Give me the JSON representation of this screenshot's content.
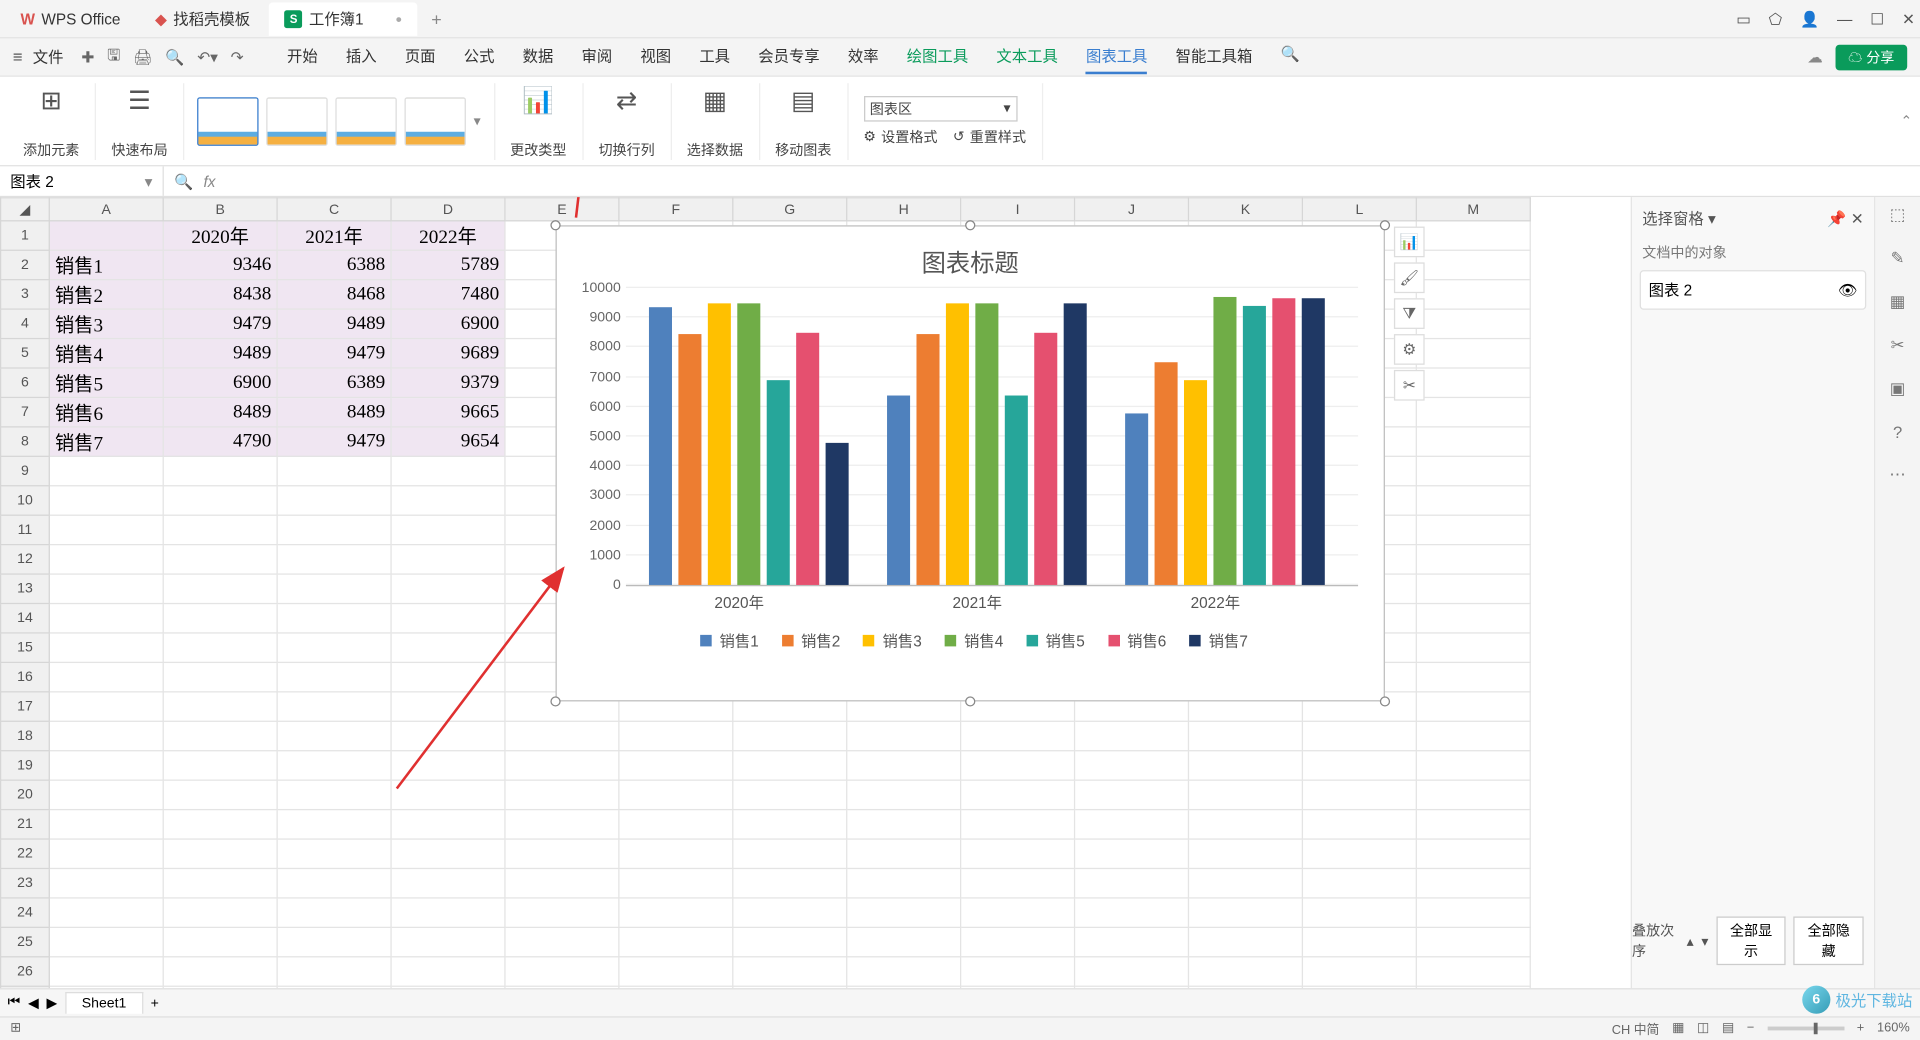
{
  "app": {
    "name": "WPS Office",
    "tab2": "找稻壳模板",
    "tab3": "工作簿1"
  },
  "menu": {
    "file": "文件",
    "tabs": [
      "开始",
      "插入",
      "页面",
      "公式",
      "数据",
      "审阅",
      "视图",
      "工具",
      "会员专享",
      "效率",
      "绘图工具",
      "文本工具",
      "图表工具",
      "智能工具箱"
    ],
    "share": "☁ 分享"
  },
  "ribbon": {
    "addEl": "添加元素",
    "quickLayout": "快速布局",
    "changeType": "更改类型",
    "switchRC": "切换行列",
    "selectData": "选择数据",
    "moveChart": "移动图表",
    "setFormat": "设置格式",
    "resetStyle": "重置样式",
    "areaSel": "图表区"
  },
  "namebox": "图表 2",
  "fx": "fx",
  "table": {
    "cols": [
      "A",
      "B",
      "C",
      "D",
      "E",
      "F",
      "G",
      "H",
      "I",
      "J",
      "K",
      "L",
      "M"
    ],
    "headers": [
      "",
      "2020年",
      "2021年",
      "2022年"
    ],
    "rows": [
      [
        "销售1",
        "9346",
        "6388",
        "5789"
      ],
      [
        "销售2",
        "8438",
        "8468",
        "7480"
      ],
      [
        "销售3",
        "9479",
        "9489",
        "6900"
      ],
      [
        "销售4",
        "9489",
        "9479",
        "9689"
      ],
      [
        "销售5",
        "6900",
        "6389",
        "9379"
      ],
      [
        "销售6",
        "8489",
        "8489",
        "9665"
      ],
      [
        "销售7",
        "4790",
        "9479",
        "9654"
      ]
    ]
  },
  "chart_data": {
    "type": "bar",
    "title": "图表标题",
    "categories": [
      "2020年",
      "2021年",
      "2022年"
    ],
    "series": [
      {
        "name": "销售1",
        "values": [
          9346,
          6388,
          5789
        ],
        "color": "#4f81bd"
      },
      {
        "name": "销售2",
        "values": [
          8438,
          8468,
          7480
        ],
        "color": "#ed7d31"
      },
      {
        "name": "销售3",
        "values": [
          9479,
          9489,
          6900
        ],
        "color": "#ffc000"
      },
      {
        "name": "销售4",
        "values": [
          9489,
          9479,
          9689
        ],
        "color": "#70ad47"
      },
      {
        "name": "销售5",
        "values": [
          6900,
          6389,
          9379
        ],
        "color": "#26a69a"
      },
      {
        "name": "销售6",
        "values": [
          8489,
          8489,
          9665
        ],
        "color": "#e5506f"
      },
      {
        "name": "销售7",
        "values": [
          4790,
          9479,
          9654
        ],
        "color": "#1f3864"
      }
    ],
    "ylim": [
      0,
      10000
    ],
    "yticks": [
      0,
      1000,
      2000,
      3000,
      4000,
      5000,
      6000,
      7000,
      8000,
      9000,
      10000
    ]
  },
  "panel": {
    "title": "选择窗格",
    "sub": "文档中的对象",
    "item": "图表 2",
    "order": "叠放次序",
    "showAll": "全部显示",
    "hideAll": "全部隐藏"
  },
  "tabs": {
    "sheet": "Sheet1"
  },
  "status": {
    "zoom": "160%",
    "lang": "CH 中简"
  },
  "watermark": "极光下载站"
}
